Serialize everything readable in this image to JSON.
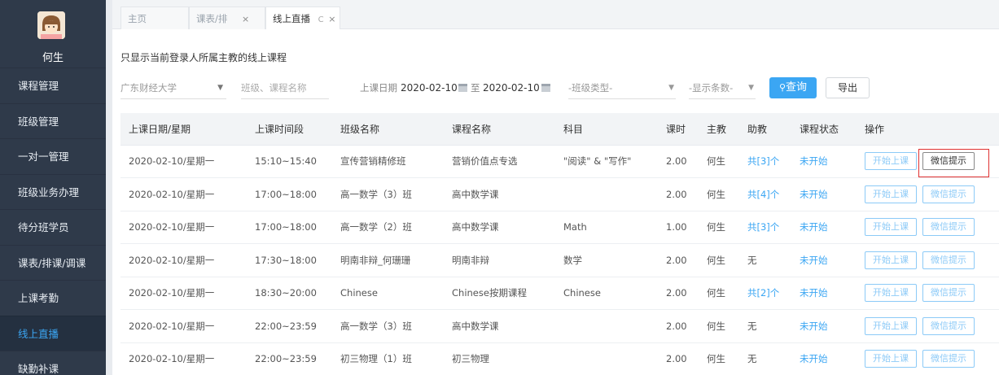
{
  "sidebar": {
    "user_name": "何生",
    "items": [
      {
        "label": "课程管理",
        "active": false
      },
      {
        "label": "班级管理",
        "active": false
      },
      {
        "label": "一对一管理",
        "active": false
      },
      {
        "label": "班级业务办理",
        "active": false
      },
      {
        "label": "待分班学员",
        "active": false
      },
      {
        "label": "课表/排课/调课",
        "active": false
      },
      {
        "label": "上课考勤",
        "active": false
      },
      {
        "label": "线上直播",
        "active": true
      },
      {
        "label": "缺勤补课",
        "active": false
      }
    ]
  },
  "tabs": [
    {
      "label": "主页"
    },
    {
      "label": "课表/排",
      "close": "×"
    },
    {
      "label": "线上直播",
      "refresh": "C",
      "close": "×"
    }
  ],
  "notice": "只显示当前登录人所属主教的线上课程",
  "filters": {
    "school": "广东财经大学",
    "search_placeholder": "班级、课程名称",
    "date_label": "上课日期",
    "date_from": "2020-02-10",
    "date_to_label": "至",
    "date_to": "2020-02-10",
    "class_type": "-班级类型-",
    "row_count": "-显示条数-",
    "query_label": "查询",
    "export_label": "导出"
  },
  "table": {
    "headers": [
      "上课日期/星期",
      "上课时间段",
      "班级名称",
      "课程名称",
      "科目",
      "课时",
      "主教",
      "助教",
      "课程状态",
      "操作"
    ],
    "rows": [
      [
        "2020-02-10/星期一",
        "15:10~15:40",
        "宣传营销精修班",
        "营销价值点专选",
        "\"阅读\" & \"写作\"",
        "2.00",
        "何生",
        "共[3]个",
        "未开始"
      ],
      [
        "2020-02-10/星期一",
        "17:00~18:00",
        "高一数学（3）班",
        "高中数学课",
        "",
        "2.00",
        "何生",
        "共[4]个",
        "未开始"
      ],
      [
        "2020-02-10/星期一",
        "17:00~18:00",
        "高一数学（2）班",
        "高中数学课",
        "Math",
        "1.00",
        "何生",
        "共[3]个",
        "未开始"
      ],
      [
        "2020-02-10/星期一",
        "17:30~18:00",
        "明南非辩_何珊珊",
        "明南非辩",
        "数学",
        "2.00",
        "何生",
        "无",
        "未开始"
      ],
      [
        "2020-02-10/星期一",
        "18:30~20:00",
        "Chinese",
        "Chinese按期课程",
        "Chinese",
        "2.00",
        "何生",
        "共[2]个",
        "未开始"
      ],
      [
        "2020-02-10/星期一",
        "22:00~23:59",
        "高一数学（3）班",
        "高中数学课",
        "",
        "2.00",
        "何生",
        "无",
        "未开始"
      ],
      [
        "2020-02-10/星期一",
        "22:00~23:59",
        "初三物理（1）班",
        "初三物理",
        "",
        "2.00",
        "何生",
        "无",
        "未开始"
      ]
    ],
    "op_start": "开始上课",
    "op_wechat": "微信提示"
  },
  "colors": {
    "accent": "#3ba6f3",
    "sidebar_bg": "#2f3a4a",
    "highlight": "#e03131"
  }
}
